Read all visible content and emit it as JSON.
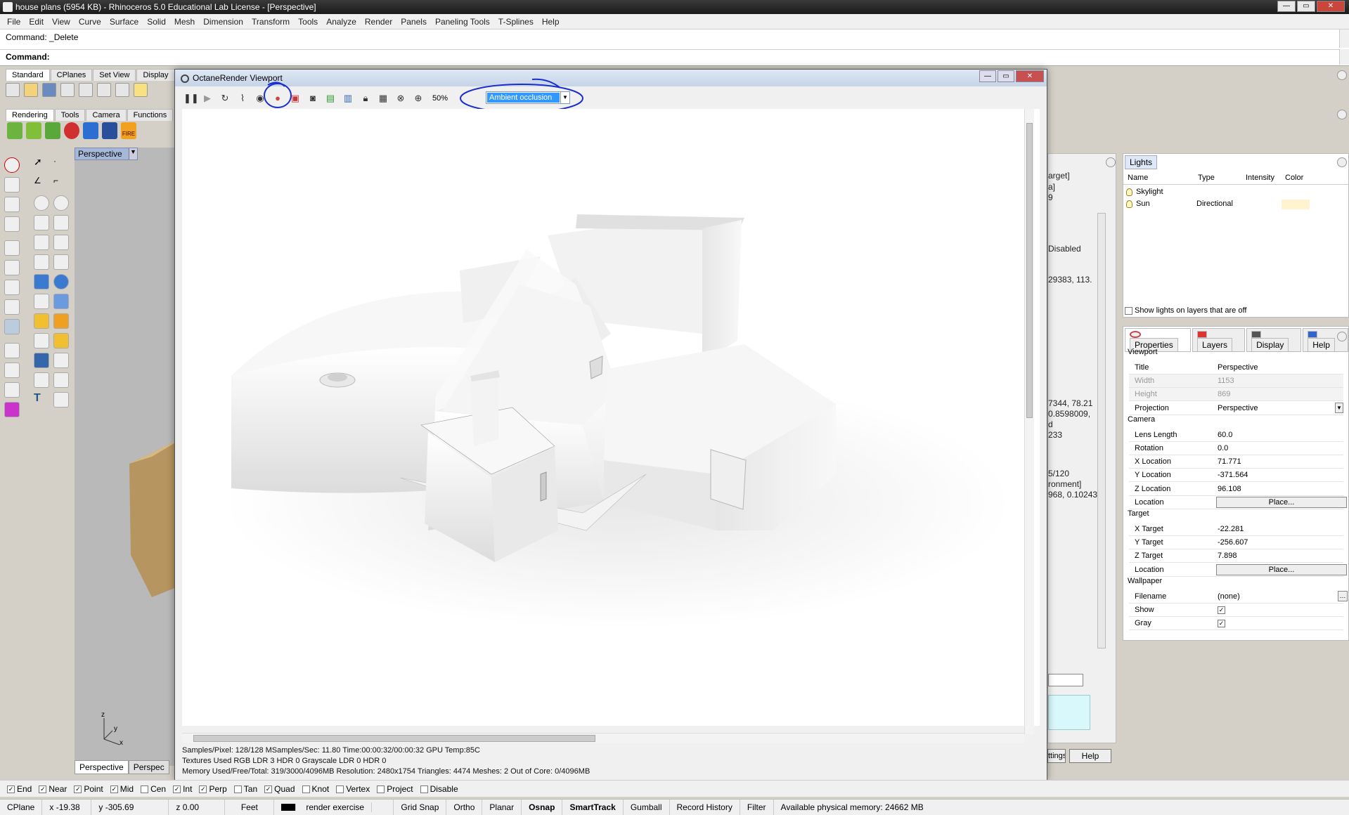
{
  "window": {
    "title": "house plans (5954 KB) - Rhinoceros 5.0 Educational Lab License - [Perspective]"
  },
  "menu": [
    "File",
    "Edit",
    "View",
    "Curve",
    "Surface",
    "Solid",
    "Mesh",
    "Dimension",
    "Transform",
    "Tools",
    "Analyze",
    "Render",
    "Panels",
    "Paneling Tools",
    "T-Splines",
    "Help"
  ],
  "command": {
    "history": "Command: _Delete",
    "prompt": "Command:"
  },
  "toolbar_tabs": [
    "Standard",
    "CPlanes",
    "Set View",
    "Display"
  ],
  "render_tabs": [
    "Rendering",
    "Tools",
    "Camera",
    "Functions"
  ],
  "fire_label": "FIRE",
  "viewport": {
    "name": "Perspective",
    "tabs": [
      "Perspective",
      "Perspec"
    ],
    "axes": {
      "x": "x",
      "y": "y",
      "z": "z"
    }
  },
  "octane": {
    "title": "OctaneRender Viewport",
    "zoom": "50%",
    "mode": "Ambient occlusion",
    "status_line1": "Samples/Pixel: 128/128  MSamples/Sec: 11.80  Time:00:00:32/00:00:32  GPU Temp:85C",
    "status_line2": "Textures Used RGB LDR 3  HDR 0  Grayscale LDR 0  HDR 0",
    "status_line3": "Memory Used/Free/Total: 319/3000/4096MB  Resolution: 2480x1754  Triangles: 4474  Meshes: 2 Out of Core: 0/4096MB"
  },
  "mid_panel": {
    "fragments": [
      "arget]",
      "a]",
      "9",
      "Disabled",
      "29383, 113.",
      "7344, 78.21",
      "0.8598009,",
      "d",
      "233",
      "5/120",
      "ronment]",
      "968, 0.10243"
    ],
    "settings_label": "ttings",
    "help_label": "Help"
  },
  "lights": {
    "tab": "Lights",
    "columns": [
      "Name",
      "Type",
      "Intensity",
      "Color"
    ],
    "rows": [
      {
        "name": "Skylight",
        "type": ""
      },
      {
        "name": "Sun",
        "type": "Directional"
      }
    ],
    "show_off_label": "Show lights on layers that are off"
  },
  "properties": {
    "tabs": [
      "Properties",
      "Layers",
      "Display",
      "Help"
    ],
    "sections": {
      "viewport": "Viewport",
      "camera": "Camera",
      "target": "Target",
      "wallpaper": "Wallpaper"
    },
    "viewport": [
      {
        "k": "Title",
        "v": "Perspective"
      },
      {
        "k": "Width",
        "v": "1153"
      },
      {
        "k": "Height",
        "v": "869"
      },
      {
        "k": "Projection",
        "v": "Perspective"
      }
    ],
    "camera": [
      {
        "k": "Lens Length",
        "v": "60.0"
      },
      {
        "k": "Rotation",
        "v": "0.0"
      },
      {
        "k": "X Location",
        "v": "71.771"
      },
      {
        "k": "Y Location",
        "v": "-371.564"
      },
      {
        "k": "Z Location",
        "v": "96.108"
      },
      {
        "k": "Location",
        "v": "Place..."
      }
    ],
    "target": [
      {
        "k": "X Target",
        "v": "-22.281"
      },
      {
        "k": "Y Target",
        "v": "-256.607"
      },
      {
        "k": "Z Target",
        "v": "7.898"
      },
      {
        "k": "Location",
        "v": "Place..."
      }
    ],
    "wallpaper": [
      {
        "k": "Filename",
        "v": "(none)"
      },
      {
        "k": "Show",
        "v": "checked"
      },
      {
        "k": "Gray",
        "v": "checked"
      }
    ]
  },
  "osnap": [
    {
      "label": "End",
      "checked": true
    },
    {
      "label": "Near",
      "checked": true
    },
    {
      "label": "Point",
      "checked": true
    },
    {
      "label": "Mid",
      "checked": true
    },
    {
      "label": "Cen",
      "checked": false
    },
    {
      "label": "Int",
      "checked": true
    },
    {
      "label": "Perp",
      "checked": true
    },
    {
      "label": "Tan",
      "checked": false
    },
    {
      "label": "Quad",
      "checked": true
    },
    {
      "label": "Knot",
      "checked": false
    },
    {
      "label": "Vertex",
      "checked": false
    },
    {
      "label": "Project",
      "checked": false
    },
    {
      "label": "Disable",
      "checked": false
    }
  ],
  "status": {
    "cplane": "CPlane",
    "x": "x -19.38",
    "y": "y -305.69",
    "z": "z 0.00",
    "units": "Feet",
    "layer": "render exercise",
    "toggles": [
      "Grid Snap",
      "Ortho",
      "Planar",
      "Osnap",
      "SmartTrack",
      "Gumball",
      "Record History",
      "Filter"
    ],
    "memory": "Available physical memory: 24662 MB"
  }
}
